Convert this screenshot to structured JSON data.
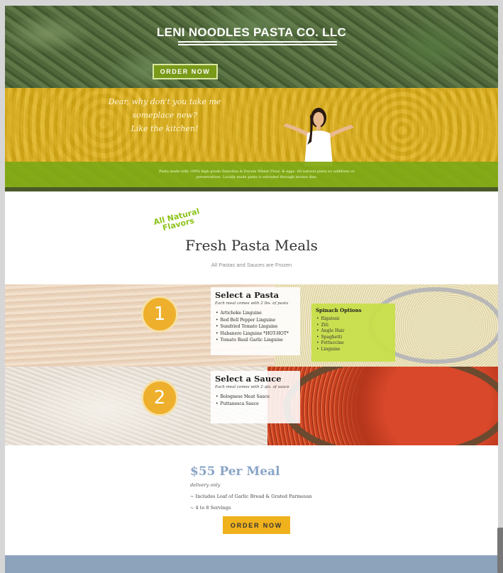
{
  "hero": {
    "title": "LENI NOODLES PASTA CO. LLC",
    "order_button": "ORDER NOW",
    "tagline_lines": [
      "Dear, why don't you take me",
      "someplace new?",
      "Like the kitchen!"
    ],
    "description": "Pasta made with 100% high grade Semolina & Durum Wheat Flour, & eggs. All natural pasta no additives or preservatives. Locally made pasta is extruded through bronze dies."
  },
  "badge": {
    "line1": "All Natural",
    "line2": "Flavors"
  },
  "meals": {
    "title": "Fresh Pasta Meals",
    "subtitle": "All Pastas and Sauces are Frozen"
  },
  "step1": {
    "number": "1",
    "title": "Select a Pasta",
    "note": "Each meal comes with 2 lbs. of pasta",
    "items": [
      "Artichoke Linguine",
      "Red Bell Pepper Linguine",
      "Sundried Tomato Linguine",
      "Habanero Linguine *HOT-HOT*",
      "Tomato Basil Garlic Linguine"
    ],
    "spinach_title": "Spinach Options",
    "spinach_items": [
      "Rigatoni",
      "Ziti",
      "Angle Hair",
      "Spaghetti",
      "Fettuccine",
      "Linguine"
    ]
  },
  "step2": {
    "number": "2",
    "title": "Select a Sauce",
    "note": "Each meal comes with 2 qts. of sauce",
    "items": [
      "Bolognese Meat Sauce",
      "Puttanesca Sauce"
    ]
  },
  "pricing": {
    "price": "$55 Per Meal",
    "delivery": "delivery only",
    "includes_1": "~ Includes Loaf of Garlic Bread & Grated Parmesan",
    "includes_2": "~ 4 to 8 Servings",
    "order_button": "ORDER NOW"
  },
  "colors": {
    "accent_yellow": "#f0b21c",
    "accent_green": "#84aa14",
    "price_blue": "#8aa5c6",
    "footer": "#8da2bb"
  }
}
